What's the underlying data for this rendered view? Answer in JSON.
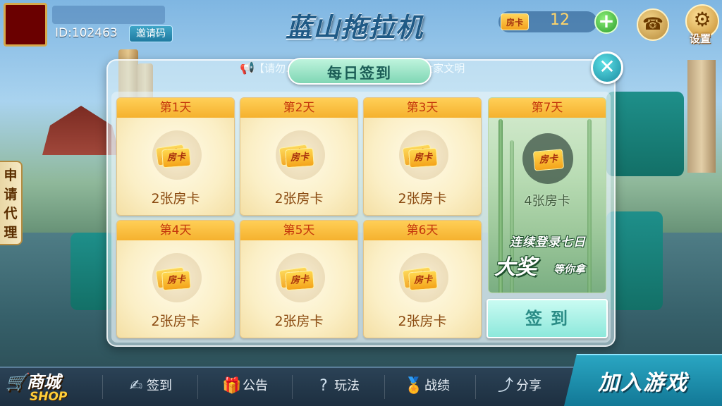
{
  "header": {
    "user_id": "ID:102463",
    "invite_label": "邀请码",
    "title": "蓝山拖拉机",
    "card_label": "房卡",
    "card_count": "12",
    "plus_label": "+",
    "settings_label": "设置"
  },
  "side": {
    "agent_label": "申请代理"
  },
  "dialog": {
    "title": "每日签到",
    "marquee": "【请勿...】欢迎来到蓝山拖拉机，请大家文明",
    "close_label": "✕",
    "card_label": "房卡",
    "days": [
      {
        "label": "第1天",
        "reward": "2张房卡"
      },
      {
        "label": "第2天",
        "reward": "2张房卡"
      },
      {
        "label": "第3天",
        "reward": "2张房卡"
      },
      {
        "label": "第4天",
        "reward": "2张房卡"
      },
      {
        "label": "第5天",
        "reward": "2张房卡"
      },
      {
        "label": "第6天",
        "reward": "2张房卡"
      }
    ],
    "day7": {
      "label": "第7天",
      "reward": "4张房卡",
      "promo_line": "连续登录七日",
      "promo_big": "大奖",
      "promo_small": "等你拿"
    },
    "sign_button": "签到"
  },
  "bottom_nav": {
    "shop_cn": "商城",
    "shop_en": "SHOP",
    "items": [
      {
        "label": "签到",
        "icon": "pen-icon"
      },
      {
        "label": "公告",
        "icon": "gift-icon"
      },
      {
        "label": "玩法",
        "icon": "question-icon"
      },
      {
        "label": "战绩",
        "icon": "medal-icon"
      },
      {
        "label": "分享",
        "icon": "share-icon"
      }
    ],
    "join_label": "加入游戏"
  }
}
